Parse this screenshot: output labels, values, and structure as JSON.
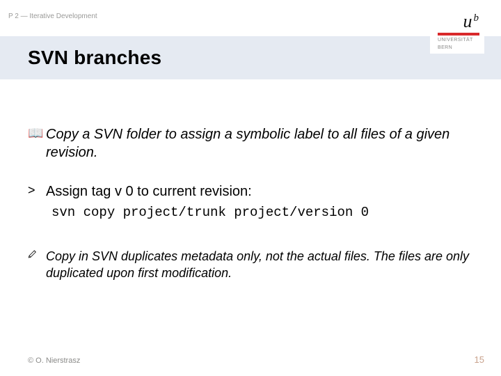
{
  "breadcrumb": "P 2 — Iterative Development",
  "title": "SVN branches",
  "logo": {
    "u": "u",
    "b": "b",
    "line1": "UNIVERSITÄT",
    "line2": "BERN"
  },
  "bullets": {
    "book_glyph": "📖",
    "copy_text": "Copy a SVN folder to assign a symbolic label to all files of a given revision.",
    "gt": ">",
    "assign_text": "Assign tag v 0 to current revision:",
    "command": "svn copy project/trunk project/version 0",
    "note_text": "Copy in SVN duplicates metadata only, not the actual files. The files are only duplicated upon first modification."
  },
  "footer": {
    "copyright": "© O. Nierstrasz",
    "page": "15"
  }
}
